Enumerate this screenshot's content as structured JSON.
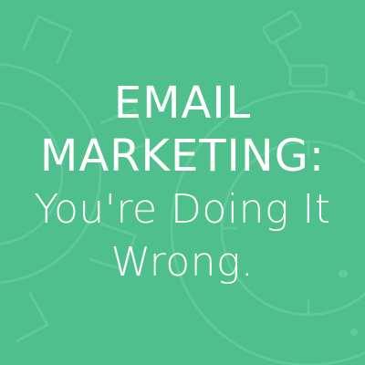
{
  "colors": {
    "background": "#4fc08d",
    "text": "#ffffff",
    "line_art": "#6fd0a4"
  },
  "headline": {
    "line1": "EMAIL",
    "line2": "MARKETING:",
    "line3": "You're Doing It",
    "line4": "Wrong."
  },
  "decorations": {
    "left_graphic": "gear-icon",
    "right_graphic": "stopwatch-icon"
  }
}
